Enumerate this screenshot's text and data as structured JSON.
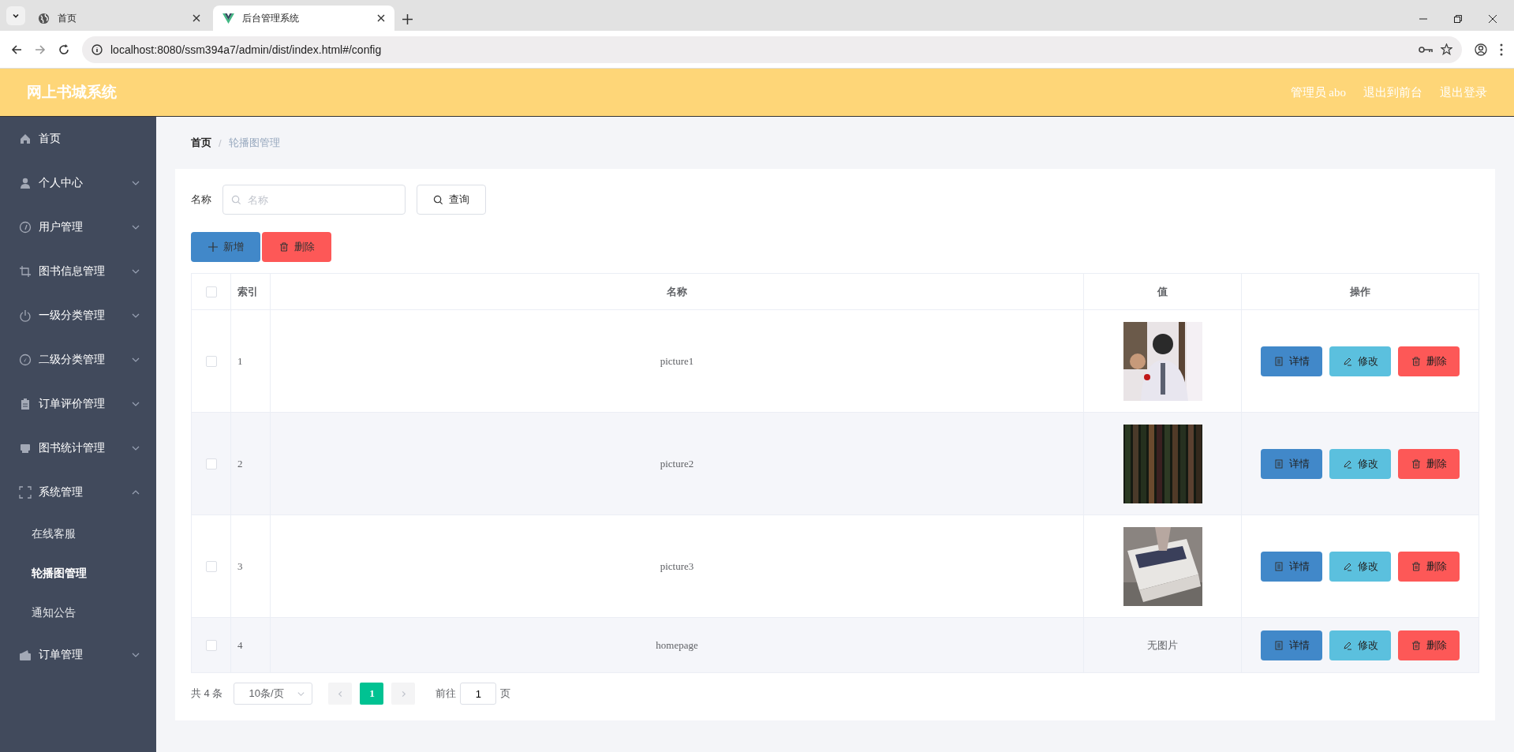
{
  "browser": {
    "tabs": [
      {
        "title": "首页",
        "selected": false,
        "kind": "globe"
      },
      {
        "title": "后台管理系统",
        "selected": true,
        "kind": "vue"
      }
    ],
    "url": "localhost:8080/ssm394a7/admin/dist/index.html#/config"
  },
  "header": {
    "title": "网上书城系统",
    "links": [
      "管理员 abo",
      "退出到前台",
      "退出登录"
    ]
  },
  "sidebar": {
    "items": [
      {
        "label": "首页"
      },
      {
        "label": "个人中心",
        "expanded": false
      },
      {
        "label": "用户管理",
        "expanded": false
      },
      {
        "label": "图书信息管理",
        "expanded": false
      },
      {
        "label": "一级分类管理",
        "expanded": false
      },
      {
        "label": "二级分类管理",
        "expanded": false
      },
      {
        "label": "订单评价管理",
        "expanded": false
      },
      {
        "label": "图书统计管理",
        "expanded": false
      },
      {
        "label": "系统管理",
        "expanded": true,
        "children": [
          {
            "label": "在线客服",
            "selected": false
          },
          {
            "label": "轮播图管理",
            "selected": true
          },
          {
            "label": "通知公告",
            "selected": false
          }
        ]
      },
      {
        "label": "订单管理",
        "expanded": false
      }
    ]
  },
  "breadcrumb": {
    "separator": "/",
    "items": [
      "首页",
      "轮播图管理"
    ]
  },
  "search": {
    "label": "名称",
    "placeholder": "名称",
    "button": "查询"
  },
  "toolbar": [
    {
      "label": "新增",
      "kind": "add"
    },
    {
      "label": "删除",
      "kind": "delete"
    }
  ],
  "table": {
    "select_all": false,
    "columns": [
      "索引",
      "名称",
      "值",
      "操作"
    ],
    "rows": [
      {
        "index": "1",
        "name": "picture1",
        "value": {
          "kind": "picture"
        },
        "checked": false,
        "actions": [
          "详情",
          "修改",
          "删除"
        ]
      },
      {
        "index": "2",
        "name": "picture2",
        "value": {
          "kind": "picture"
        },
        "checked": false,
        "actions": [
          "详情",
          "修改",
          "删除"
        ]
      },
      {
        "index": "3",
        "name": "picture3",
        "value": {
          "kind": "picture"
        },
        "checked": false,
        "actions": [
          "详情",
          "修改",
          "删除"
        ]
      },
      {
        "index": "4",
        "name": "homepage",
        "value": {
          "kind": "text",
          "text": "无图片"
        },
        "checked": false,
        "actions": [
          "详情",
          "修改",
          "删除"
        ]
      }
    ]
  },
  "pagination": {
    "total": "共 4 条",
    "page_size": "10条/页",
    "pages": [
      {
        "label": "1",
        "selected": true
      }
    ],
    "goto_label": "前往",
    "goto_value": "1",
    "page_unit": "页"
  }
}
